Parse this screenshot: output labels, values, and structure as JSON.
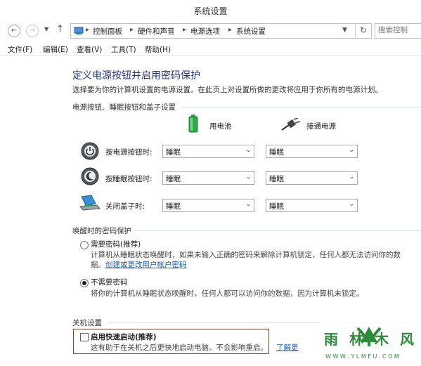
{
  "window": {
    "title": "系统设置"
  },
  "breadcrumb": {
    "items": [
      "控制面板",
      "硬件和声音",
      "电源选项",
      "系统设置"
    ]
  },
  "search": {
    "placeholder": "搜索控制"
  },
  "menu": {
    "items": [
      "文件(F)",
      "编辑(E)",
      "查看(V)",
      "工具(T)",
      "帮助(H)"
    ]
  },
  "page": {
    "title": "定义电源按钮并启用密码保护",
    "subtitle": "选择要为你的计算机设置的电源设置。在此页上对设置所做的更改将应用于你所有的电源计划。"
  },
  "power_section": {
    "header": "电源按钮、睡眠按钮和盖子设置",
    "col_battery": "用电池",
    "col_plugged": "接通电源",
    "rows": [
      {
        "label": "按电源按钮时:",
        "battery": "睡眠",
        "plugged": "睡眠"
      },
      {
        "label": "按睡眠按钮时:",
        "battery": "睡眠",
        "plugged": "睡眠"
      },
      {
        "label": "关闭盖子时:",
        "battery": "睡眠",
        "plugged": "睡眠"
      }
    ]
  },
  "wake_section": {
    "header": "唤醒时的密码保护",
    "require": {
      "label": "需要密码(推荐)",
      "desc": "计算机从睡眠状态唤醒时，如果未输入正确的密码来解除计算机锁定，任何人都无法访问你的数",
      "desc2": "据。",
      "link": "创建或更改用户帐户密码",
      "selected": false
    },
    "norequire": {
      "label": "不需要密码",
      "desc": "将你的计算机从睡眠状态唤醒时，任何人都可以访问你的数据，因为计算机未锁定。",
      "selected": true
    }
  },
  "shutdown_section": {
    "header": "关机设置",
    "fast_startup": {
      "label": "启用快速启动(推荐)",
      "desc": "这有助于在关机之后更快地启动电脑。不会影响重启。",
      "link": "了解更",
      "checked": false
    }
  },
  "watermark": {
    "text": "雨林木风",
    "url": "W W W . Y L M F U . C O M"
  },
  "colors": {
    "title_blue": "#1e3287",
    "link": "#1a5fb4",
    "battery_green": "#2da84a",
    "watermark_green": "#2e8b3a"
  }
}
